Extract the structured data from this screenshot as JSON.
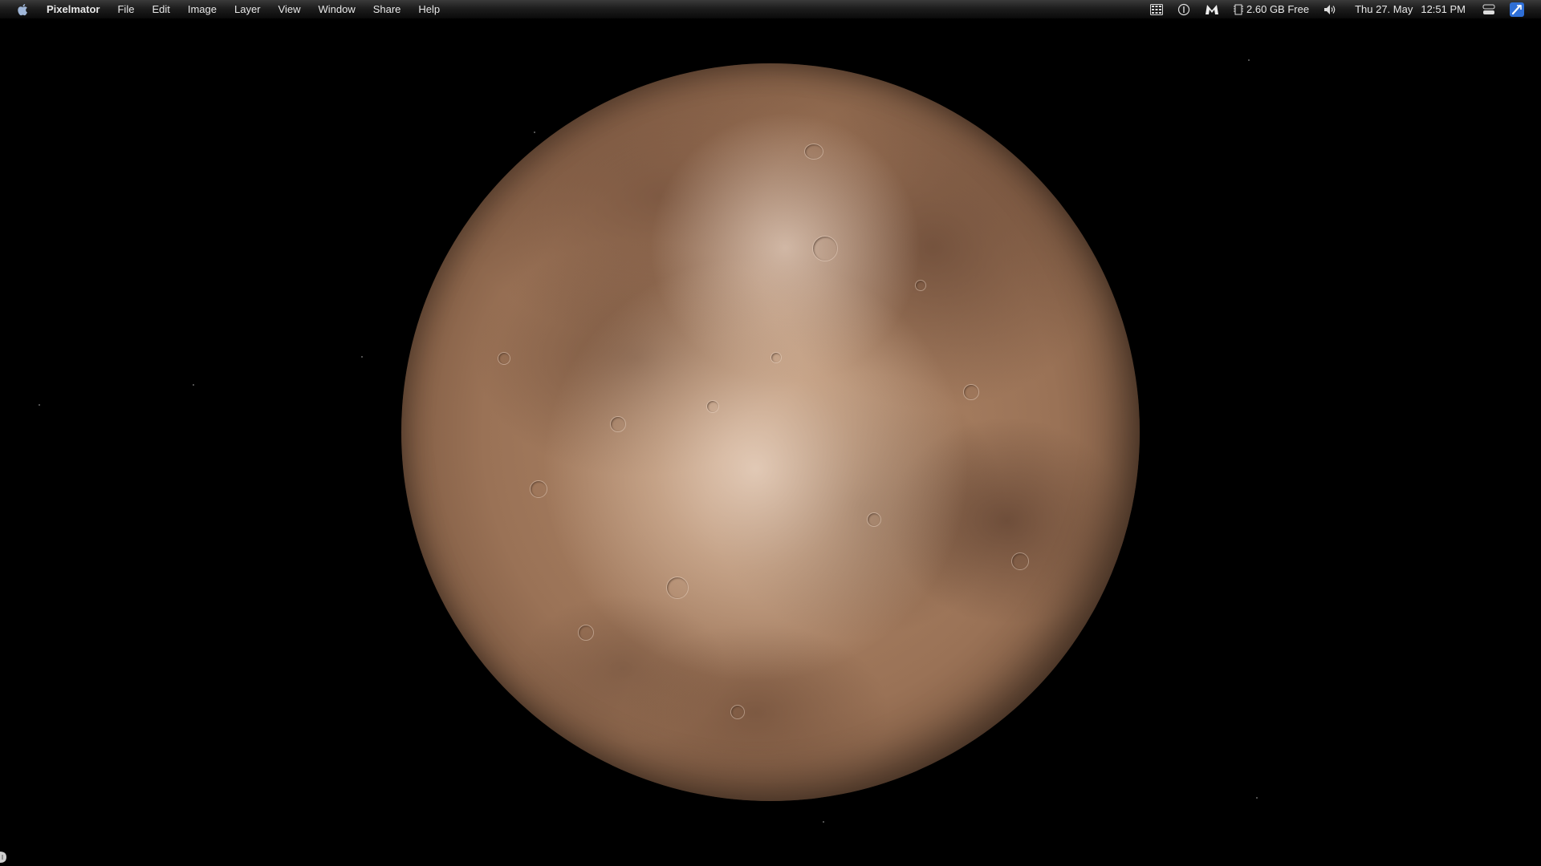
{
  "menubar": {
    "app_name": "Pixelmator",
    "menus": [
      "File",
      "Edit",
      "Image",
      "Layer",
      "View",
      "Window",
      "Share",
      "Help"
    ],
    "status": {
      "memory": "2.60 GB Free",
      "date": "Thu 27. May",
      "time": "12:51 PM"
    },
    "icons": [
      "apple-icon",
      "calculator-icon",
      "clock-menu-icon",
      "malwarebytes-icon",
      "memory-chip-icon",
      "volume-icon",
      "user-switch-icon",
      "spotlight-icon"
    ]
  },
  "desktop": {
    "wallpaper": "full-moon",
    "colors": {
      "background": "#000000",
      "moon_base": "#9a7256",
      "moon_highlight": "#ecd6c4",
      "moon_mare": "#6e4c36",
      "menubar_text": "#e8e8e8"
    }
  }
}
